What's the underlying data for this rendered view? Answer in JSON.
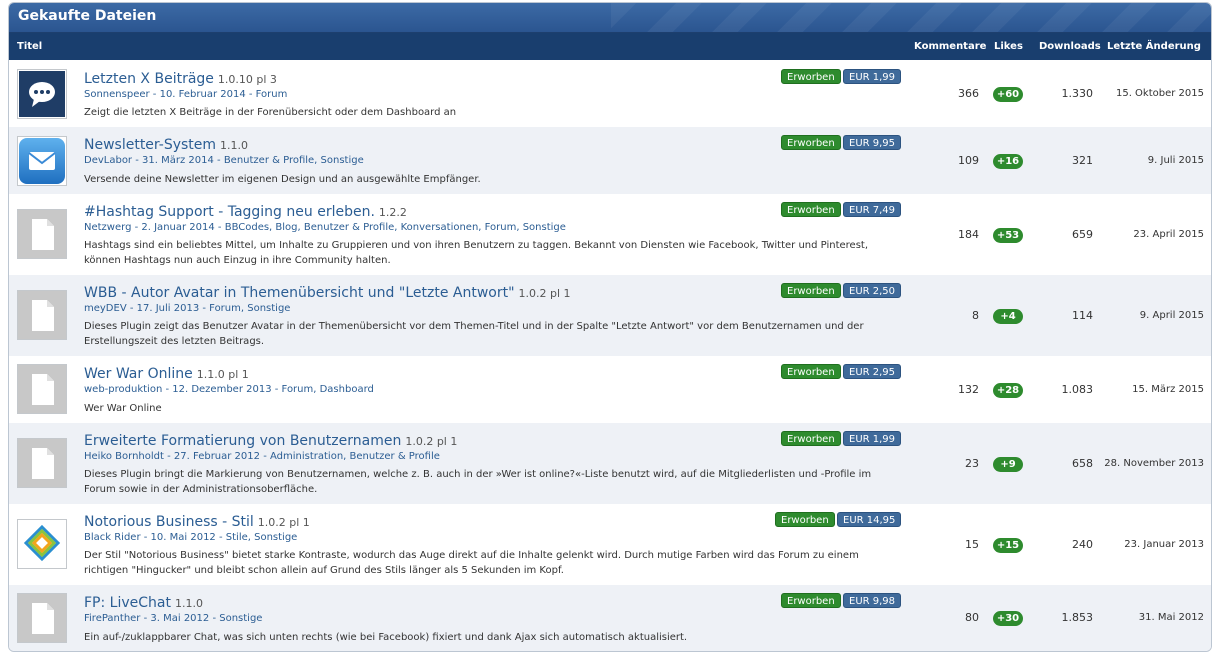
{
  "header": {
    "title": "Gekaufte Dateien"
  },
  "columns": {
    "titel": "Titel",
    "kommentare": "Kommentare",
    "likes": "Likes",
    "downloads": "Downloads",
    "letzte": "Letzte Änderung"
  },
  "rows": [
    {
      "title": "Letzten X Beiträge",
      "version": "1.0.10 pl 3",
      "author": "Sonnenspeer",
      "date": "10. Februar 2014",
      "categories": "Forum",
      "desc": "Zeigt die letzten X Beiträge in der Forenübersicht oder dem Dashboard an",
      "status": "Erworben",
      "price": "EUR 1,99",
      "comments": "366",
      "likes": "+60",
      "downloads": "1.330",
      "changed": "15. Oktober 2015",
      "icon": "speech-bubble-icon"
    },
    {
      "title": "Newsletter-System",
      "version": "1.1.0",
      "author": "DevLabor",
      "date": "31. März 2014",
      "categories": "Benutzer & Profile, Sonstige",
      "desc": "Versende deine Newsletter im eigenen Design und an ausgewählte Empfänger.",
      "status": "Erworben",
      "price": "EUR 9,95",
      "comments": "109",
      "likes": "+16",
      "downloads": "321",
      "changed": "9. Juli 2015",
      "icon": "envelope-icon"
    },
    {
      "title": "#Hashtag Support - Tagging neu erleben.",
      "version": "1.2.2",
      "author": "Netzwerg",
      "date": "2. Januar 2014",
      "categories": "BBCodes, Blog, Benutzer & Profile, Konversationen, Forum, Sonstige",
      "desc": "Hashtags sind ein beliebtes Mittel, um Inhalte zu Gruppieren und von ihren Benutzern zu taggen. Bekannt von Diensten wie Facebook, Twitter und Pinterest, können Hashtags nun auch Einzug in ihre Community halten.",
      "status": "Erworben",
      "price": "EUR 7,49",
      "comments": "184",
      "likes": "+53",
      "downloads": "659",
      "changed": "23. April 2015",
      "icon": "document-icon"
    },
    {
      "title": "WBB - Autor Avatar in Themenübersicht und \"Letzte Antwort\"",
      "version": "1.0.2 pl 1",
      "author": "meyDEV",
      "date": "17. Juli 2013",
      "categories": "Forum, Sonstige",
      "desc": "Dieses Plugin zeigt das Benutzer Avatar in der Themenübersicht vor dem Themen-Titel und in der Spalte \"Letzte Antwort\" vor dem Benutzernamen und der Erstellungszeit des letzten Beitrags.",
      "status": "Erworben",
      "price": "EUR 2,50",
      "comments": "8",
      "likes": "+4",
      "downloads": "114",
      "changed": "9. April 2015",
      "icon": "document-icon"
    },
    {
      "title": "Wer War Online",
      "version": "1.1.0 pl 1",
      "author": "web-produktion",
      "date": "12. Dezember 2013",
      "categories": "Forum, Dashboard",
      "desc": "Wer War Online",
      "status": "Erworben",
      "price": "EUR 2,95",
      "comments": "132",
      "likes": "+28",
      "downloads": "1.083",
      "changed": "15. März 2015",
      "icon": "document-icon"
    },
    {
      "title": "Erweiterte Formatierung von Benutzernamen",
      "version": "1.0.2 pl 1",
      "author": "Heiko Bornholdt",
      "date": "27. Februar 2012",
      "categories": "Administration, Benutzer & Profile",
      "desc": "Dieses Plugin bringt die Markierung von Benutzernamen, welche z. B. auch in der »Wer ist online?«-Liste benutzt wird, auf die Mitgliederlisten und -Profile im Forum sowie in der Administrationsoberfläche.",
      "status": "Erworben",
      "price": "EUR 1,99",
      "comments": "23",
      "likes": "+9",
      "downloads": "658",
      "changed": "28. November 2013",
      "icon": "document-icon"
    },
    {
      "title": "Notorious Business - Stil",
      "version": "1.0.2 pl 1",
      "author": "Black Rider",
      "date": "10. Mai 2012",
      "categories": "Stile, Sonstige",
      "desc": "Der Stil \"Notorious Business\" bietet starke Kontraste, wodurch das Auge direkt auf die Inhalte gelenkt wird. Durch mutige Farben wird das Forum zu einem richtigen \"Hingucker\" und bleibt schon allein auf Grund des Stils länger als 5 Sekunden im Kopf.",
      "status": "Erworben",
      "price": "EUR 14,95",
      "comments": "15",
      "likes": "+15",
      "downloads": "240",
      "changed": "23. Januar 2013",
      "icon": "diamond-logo-icon"
    },
    {
      "title": "FP: LiveChat",
      "version": "1.1.0",
      "author": "FirePanther",
      "date": "3. Mai 2012",
      "categories": "Sonstige",
      "desc": "Ein auf-/zuklappbarer Chat, was sich unten rechts (wie bei Facebook) fixiert und dank Ajax sich automatisch aktualisiert.",
      "status": "Erworben",
      "price": "EUR 9,98",
      "comments": "80",
      "likes": "+30",
      "downloads": "1.853",
      "changed": "31. Mai 2012",
      "icon": "document-icon"
    }
  ]
}
